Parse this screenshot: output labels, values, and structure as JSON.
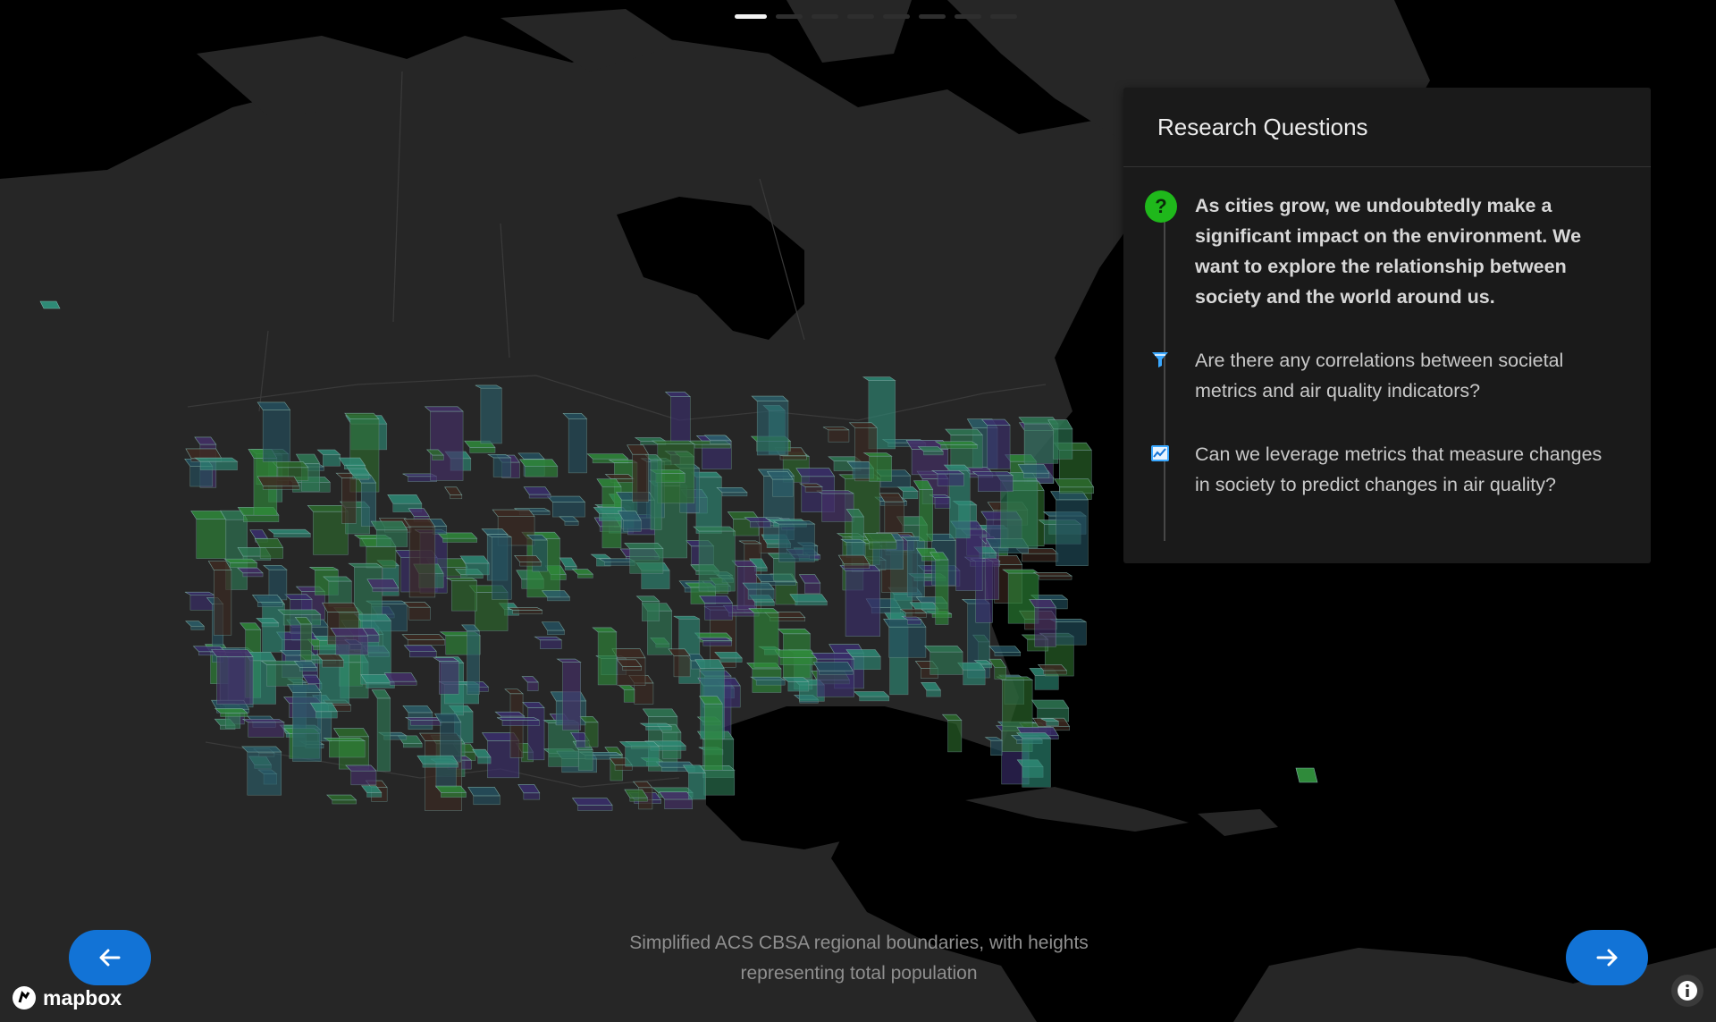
{
  "progress": {
    "total": 8,
    "current": 1
  },
  "panel": {
    "title": "Research Questions",
    "questions": [
      {
        "icon": "question-icon",
        "text": "As cities grow, we undoubtedly make a significant impact on the environment. We want to explore the relationship between society and the world around us."
      },
      {
        "icon": "funnel-icon",
        "text": "Are there any correlations between societal metrics and air quality indicators?"
      },
      {
        "icon": "line-chart-icon",
        "text": "Can we leverage metrics that measure changes in society to predict changes in air quality?"
      }
    ]
  },
  "caption": {
    "line1": "Simplified ACS CBSA regional boundaries, with heights",
    "line2": "representing total population"
  },
  "logo": {
    "text": "mapbox"
  },
  "nav": {
    "prev_icon": "arrow-left-icon",
    "next_icon": "arrow-right-icon"
  },
  "colors": {
    "accent": "#1273d6",
    "question_icon": "#1fb81b",
    "panel_bg": "#1a1a1a",
    "land": "#262626",
    "water": "#000000"
  }
}
